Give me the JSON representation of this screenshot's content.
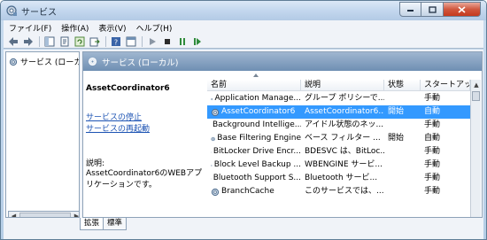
{
  "window": {
    "title": "サービス"
  },
  "menu": [
    "ファイル(F)",
    "操作(A)",
    "表示(V)",
    "ヘルプ(H)"
  ],
  "toolbar": {
    "icons": [
      "back-icon",
      "forward-icon",
      "show-hide-tree-icon",
      "properties-icon",
      "refresh-icon",
      "export-icon",
      "help-icon",
      "console-icon",
      "start-icon",
      "stop-icon",
      "pause-icon",
      "restart-icon"
    ]
  },
  "tree": {
    "root_label": "サービス (ローカ"
  },
  "pane": {
    "header": "サービス (ローカル)"
  },
  "description": {
    "service_name": "AssetCoordinator6",
    "stop_link": "サービスの停止",
    "restart_link": "サービスの再起動",
    "label": "説明:",
    "text": "AssetCoordinator6のWEBアプリケーションです。"
  },
  "list": {
    "columns": [
      "名前",
      "説明",
      "状態",
      "スタートアップ"
    ],
    "rows": [
      {
        "name": "Application Manage...",
        "desc": "グループ ポリシーで...",
        "status": "",
        "startup": "手動"
      },
      {
        "name": "AssetCoordinator6",
        "desc": "AssetCoordinator6...",
        "status": "開始",
        "startup": "自動"
      },
      {
        "name": "Background Intellige...",
        "desc": "アイドル状態のネッ...",
        "status": "",
        "startup": "手動"
      },
      {
        "name": "Base Filtering Engine",
        "desc": "ベース フィルター ...",
        "status": "開始",
        "startup": "自動"
      },
      {
        "name": "BitLocker Drive Encr...",
        "desc": "BDESVC は、BitLoc...",
        "status": "",
        "startup": "手動"
      },
      {
        "name": "Block Level Backup ...",
        "desc": "WBENGINE サービ...",
        "status": "",
        "startup": "手動"
      },
      {
        "name": "Bluetooth Support S...",
        "desc": "Bluetooth サービ...",
        "status": "",
        "startup": "手動"
      },
      {
        "name": "BranchCache",
        "desc": "このサービスでは、...",
        "status": "",
        "startup": "手動"
      }
    ],
    "selected_index": 1
  },
  "tabs": [
    "拡張",
    "標準"
  ],
  "colors": {
    "selection": "#3399ff",
    "link": "#1c53b3",
    "header_gradient": "#6f8fb3"
  }
}
